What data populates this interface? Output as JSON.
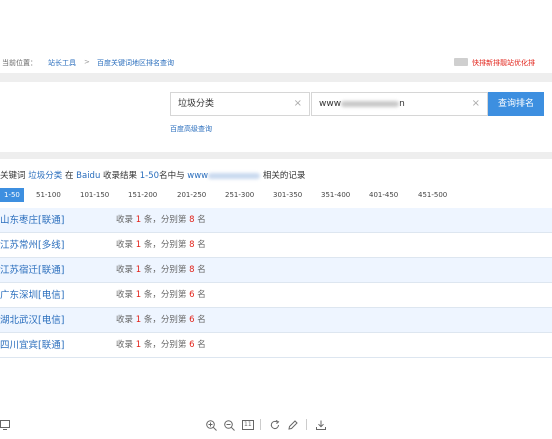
{
  "breadcrumb": {
    "label": "当前位置：",
    "tools_link": "站长工具",
    "separator": ">",
    "current": "百度关键词地区排名查询",
    "promo": "快排新排靓站优化排"
  },
  "form": {
    "keyword_value": "垃圾分类",
    "site_prefix": "www",
    "site_suffix": "n",
    "clear_icon": "×",
    "submit_label": "查询排名",
    "advanced_link": "百度高级查询"
  },
  "summary": {
    "p1": "关键词",
    "keyword": "垃圾分类",
    "p2": "在",
    "engine": "Baidu",
    "p3": "收录结果",
    "range": "1-50",
    "p4": "名中与",
    "site_prefix": "www",
    "p5": "相关的记录"
  },
  "pagination": [
    "1-50",
    "51-100",
    "101-150",
    "151-200",
    "201-250",
    "251-300",
    "301-350",
    "351-400",
    "401-450",
    "451-500"
  ],
  "results": [
    {
      "location": "山东枣庄[联通]",
      "pre": "收录",
      "count": "1",
      "mid": "条，分别第",
      "rank": "8",
      "post": "名"
    },
    {
      "location": "江苏常州[多线]",
      "pre": "收录",
      "count": "1",
      "mid": "条，分别第",
      "rank": "8",
      "post": "名"
    },
    {
      "location": "江苏宿迁[联通]",
      "pre": "收录",
      "count": "1",
      "mid": "条，分别第",
      "rank": "8",
      "post": "名"
    },
    {
      "location": "广东深圳[电信]",
      "pre": "收录",
      "count": "1",
      "mid": "条，分别第",
      "rank": "6",
      "post": "名"
    },
    {
      "location": "湖北武汉[电信]",
      "pre": "收录",
      "count": "1",
      "mid": "条，分别第",
      "rank": "6",
      "post": "名"
    },
    {
      "location": "四川宜宾[联通]",
      "pre": "收录",
      "count": "1",
      "mid": "条，分别第",
      "rank": "6",
      "post": "名"
    }
  ],
  "toolbar": {
    "page_badge": "11",
    "icons": [
      "monitor-icon",
      "zoom-in-icon",
      "zoom-out-icon",
      "page-fit-icon",
      "rotate-icon",
      "pen-icon",
      "download-icon"
    ]
  },
  "colors": {
    "link_blue": "#2a6ebd",
    "accent_blue": "#3d8fe0",
    "number_red": "#e2231a",
    "row_bg": "#eef5ff"
  }
}
